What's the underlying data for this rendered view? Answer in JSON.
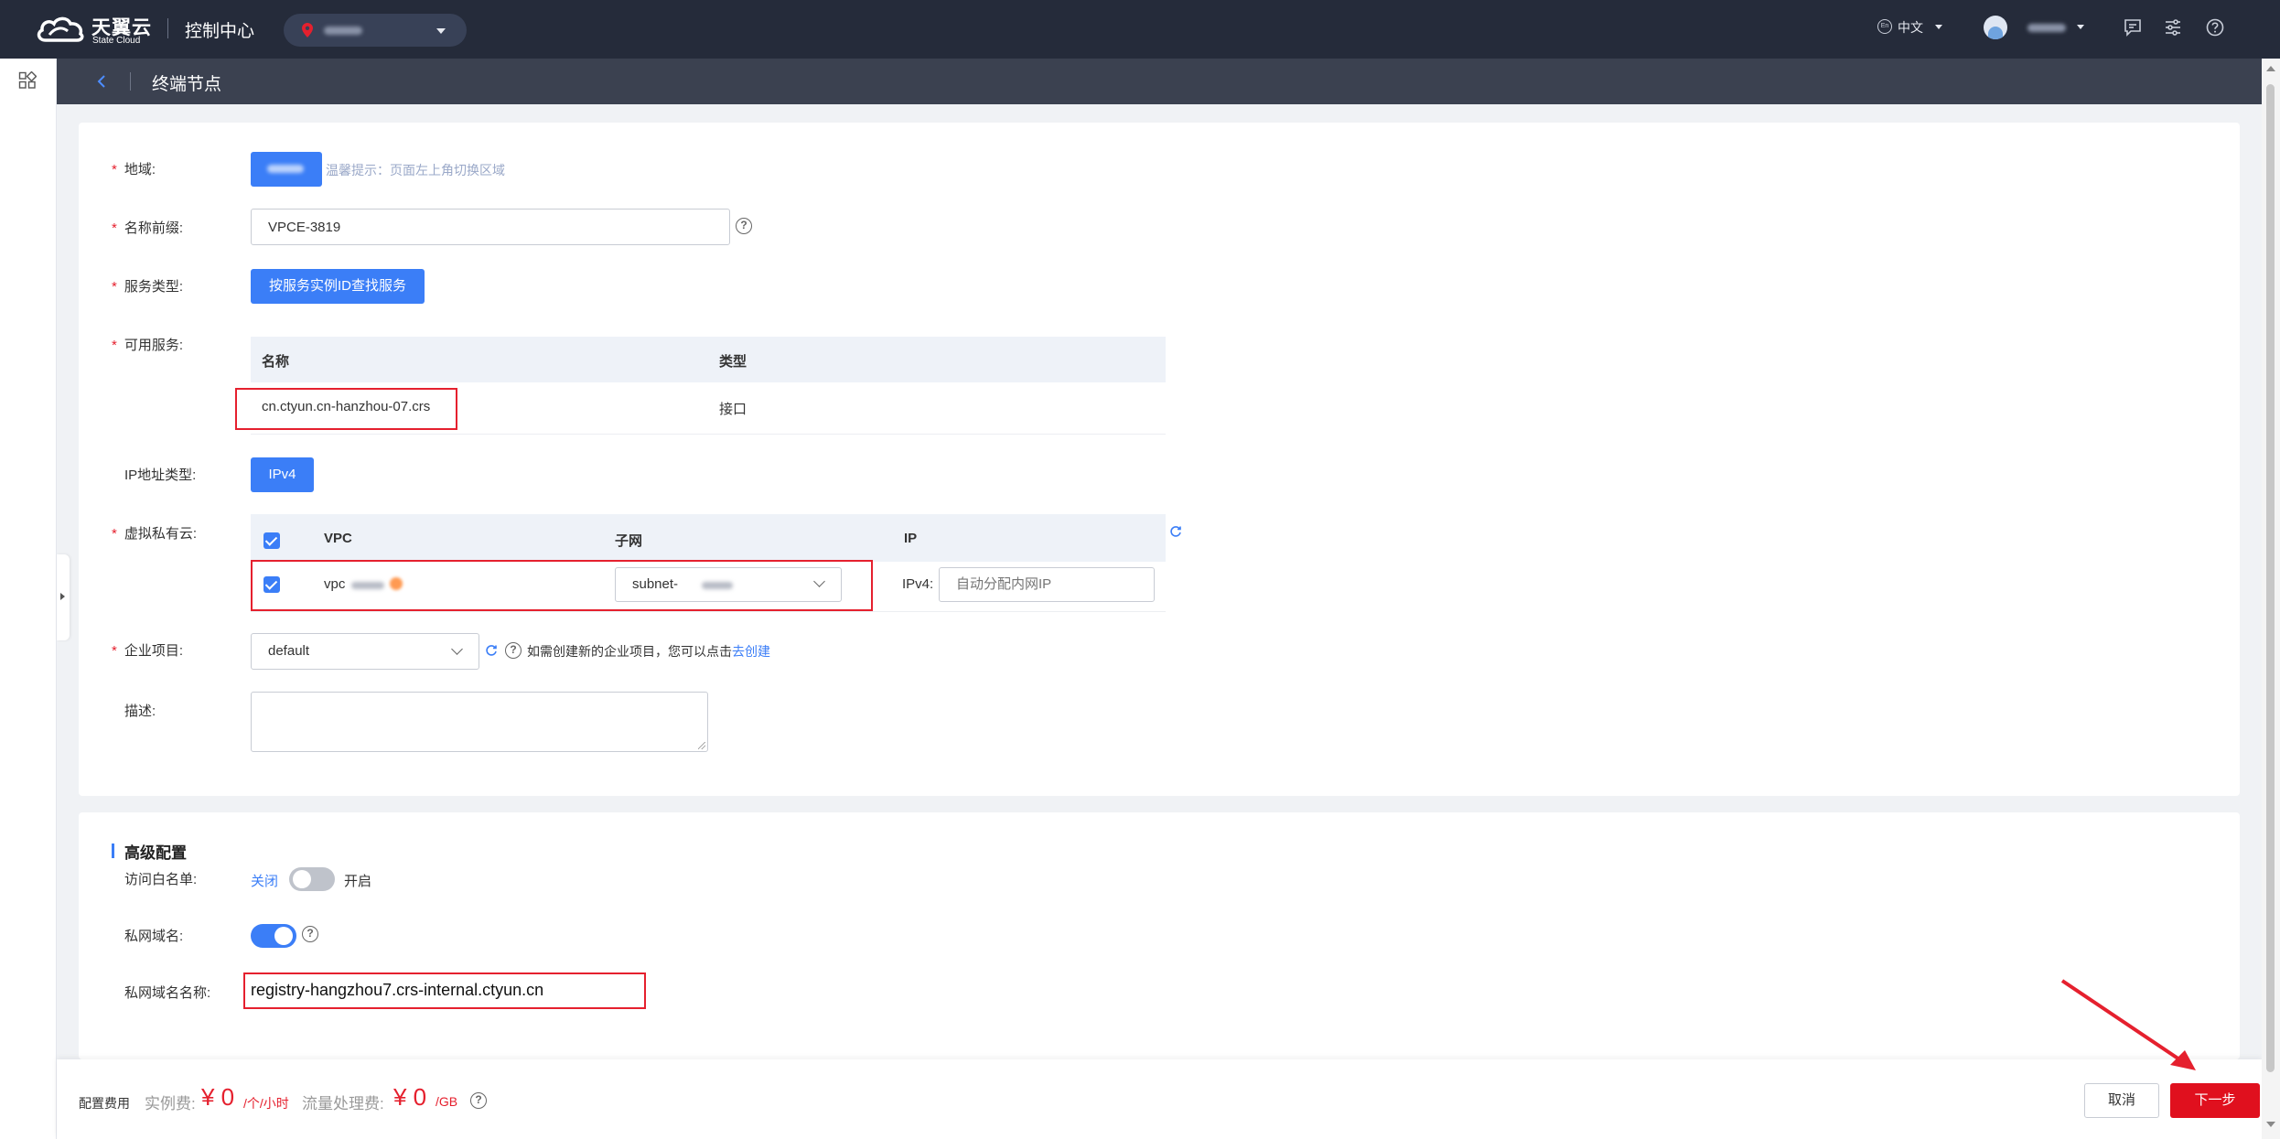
{
  "topbar": {
    "brand_cn": "天翼云",
    "brand_en": "State Cloud",
    "console_title": "控制中心",
    "language": "中文",
    "icons": [
      "cloud-logo-icon",
      "location-pin-icon",
      "language-icon",
      "message-icon",
      "settings-icon",
      "help-icon"
    ]
  },
  "subheader": {
    "title": "终端节点"
  },
  "form": {
    "region": {
      "label": "地域:",
      "hint": "温馨提示：页面左上角切换区域"
    },
    "name_prefix": {
      "label": "名称前缀:",
      "value": "VPCE-3819"
    },
    "service_type": {
      "label": "服务类型:",
      "button": "按服务实例ID查找服务"
    },
    "available_service": {
      "label": "可用服务:",
      "columns": [
        "名称",
        "类型"
      ],
      "rows": [
        {
          "name": "cn.ctyun.cn-hanzhou-07.crs",
          "type": "接口"
        }
      ]
    },
    "ip_type": {
      "label": "IP地址类型:",
      "button": "IPv4"
    },
    "vpc": {
      "label": "虚拟私有云:",
      "columns": [
        "VPC",
        "子网",
        "IP"
      ],
      "row": {
        "vpc_prefix": "vpc",
        "subnet_prefix": "subnet-",
        "ip_label": "IPv4:",
        "ip_placeholder": "自动分配内网IP"
      }
    },
    "enterprise_project": {
      "label": "企业项目:",
      "value": "default",
      "hint": "如需创建新的企业项目，您可以点击",
      "link": "去创建"
    },
    "description": {
      "label": "描述:"
    }
  },
  "advanced": {
    "title": "高级配置",
    "whitelist": {
      "label": "访问白名单:",
      "off_text": "关闭",
      "on_text": "开启",
      "enabled": false
    },
    "private_dns": {
      "label": "私网域名:",
      "enabled": true
    },
    "private_dns_name": {
      "label": "私网域名名称:",
      "value": "registry-hangzhou7.crs-internal.ctyun.cn"
    }
  },
  "footer": {
    "fee_label": "配置费用",
    "instance_fee_label": "实例费:",
    "instance_fee": "¥ 0",
    "instance_fee_unit": "/个/小时",
    "traffic_fee_label": "流量处理费:",
    "traffic_fee": "¥ 0",
    "traffic_fee_unit": "/GB",
    "cancel": "取消",
    "next": "下一步"
  },
  "colors": {
    "accent": "#3b7ef7",
    "danger": "#e0101e",
    "topbar": "#252b3a",
    "annotation_red": "#e5202e"
  }
}
